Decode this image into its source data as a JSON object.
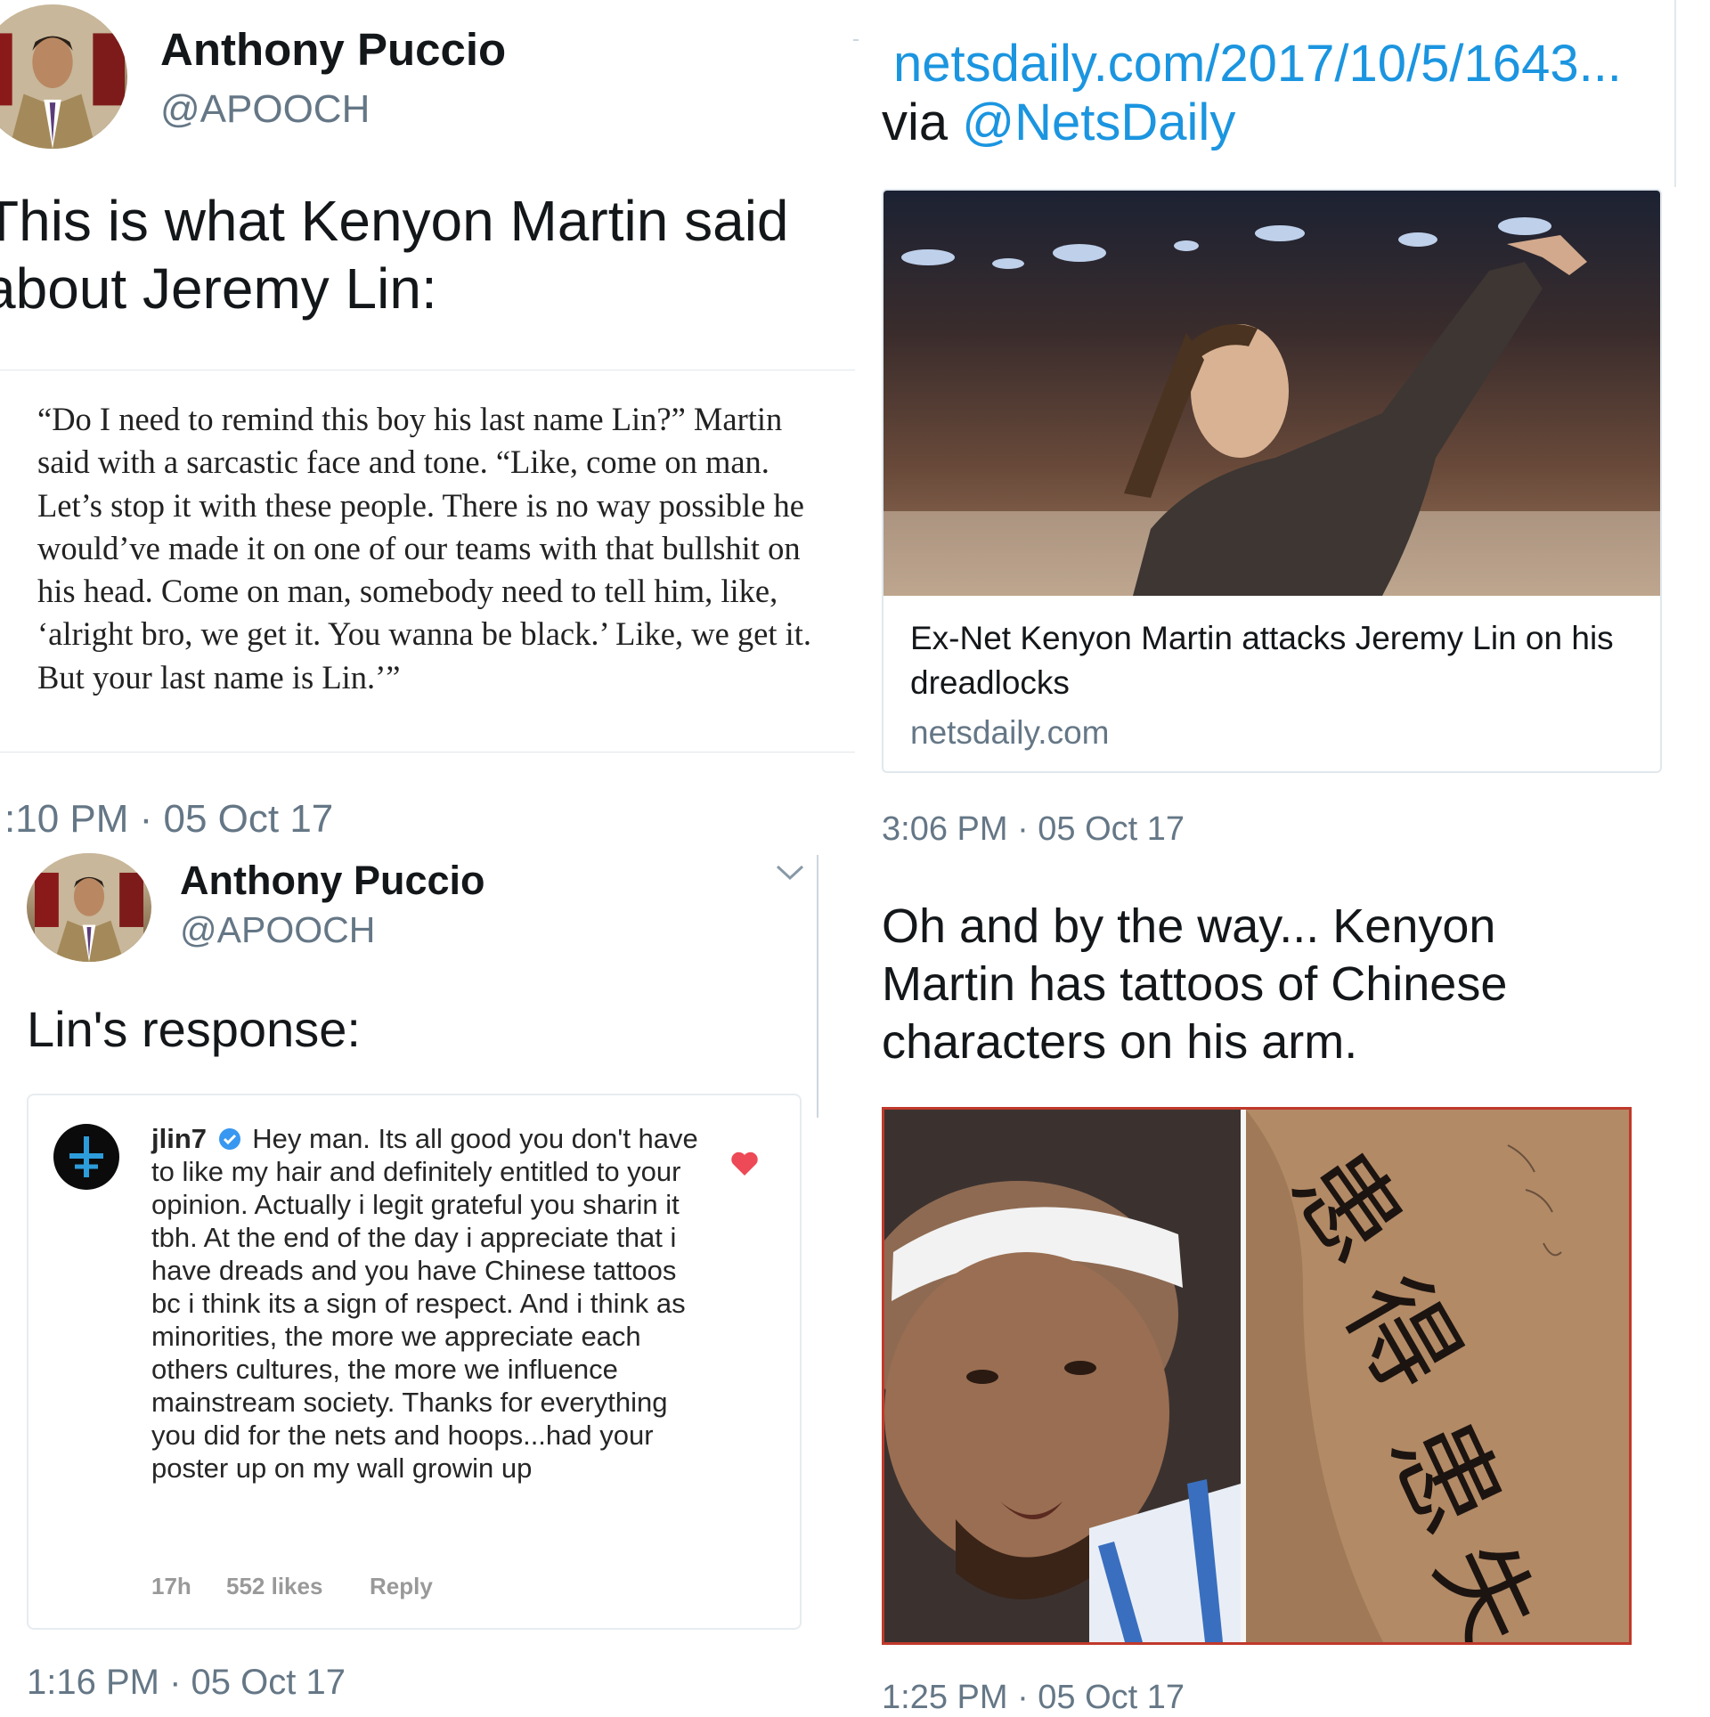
{
  "left_top": {
    "author_name": "Anthony Puccio",
    "author_handle": "@APOOCH",
    "tweet_text": "This is what Kenyon Martin said about Jeremy Lin:",
    "quote": "“Do I need to remind this boy his last name Lin?” Martin said with a sarcastic face and tone. “Like, come on man. Let’s stop it with these people. There is no way possible he would’ve made it on one of our teams with that bullshit on his head. Come on man, somebody need to tell him, like, ‘alright bro, we get it. You wanna be black.’ Like, we get it. But your last name is Lin.’”",
    "timestamp": ":10 PM · 05 Oct 17"
  },
  "left_bottom": {
    "author_name": "Anthony Puccio",
    "author_handle": "@APOOCH",
    "tweet_text": "Lin's response:",
    "comment": {
      "username": "jlin7",
      "text": "Hey man. Its all good you don't have to like my hair and definitely entitled to your opinion. Actually i legit grateful you sharin it tbh. At the end of the day i appreciate that i have dreads and you have Chinese tattoos bc i think its a sign of respect. And i think as minorities, the more we appreciate each others cultures, the more we influence mainstream society. Thanks for everything you did for the nets and hoops...had your poster up on my wall growin up",
      "age": "17h",
      "likes": "552 likes",
      "reply": "Reply"
    },
    "timestamp": "1:16 PM · 05 Oct 17"
  },
  "right_top": {
    "link_text": "netsdaily.com/2017/10/5/1643...",
    "via_prefix": "via ",
    "via_handle": "@NetsDaily",
    "card_title": "Ex-Net Kenyon Martin attacks Jeremy Lin on his dreadlocks",
    "card_domain": "netsdaily.com",
    "timestamp": "3:06 PM · 05 Oct 17"
  },
  "right_bottom": {
    "tweet_text": "Oh and by the way... Kenyon Martin has tattoos of Chinese characters on his arm.",
    "tattoo_chars": [
      "患",
      "得",
      "患",
      "失"
    ],
    "timestamp": "1:25 PM · 05 Oct 17"
  },
  "colors": {
    "link_blue": "#1b95e0",
    "gray": "#657786",
    "heart_red": "#ed4956",
    "verified_blue": "#3897f0",
    "photo_border": "#c0392b"
  },
  "icons": [
    "chevron-down-icon",
    "verified-badge-icon",
    "heart-icon",
    "lin-logo-icon"
  ]
}
